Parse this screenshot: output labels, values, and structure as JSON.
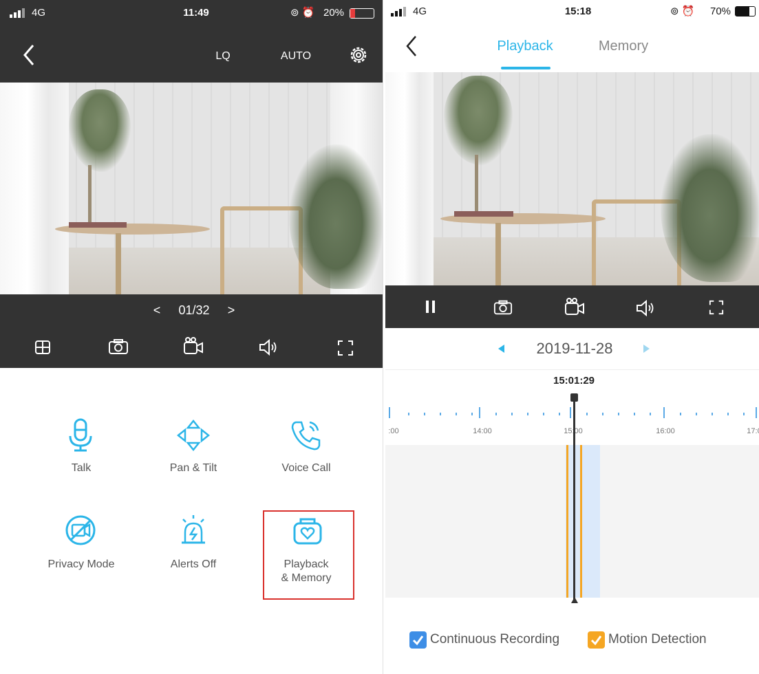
{
  "left": {
    "status": {
      "signal": "4G",
      "time": "11:49",
      "battery": "20%"
    },
    "header": {
      "quality": "LQ",
      "mode": "AUTO",
      "back_icon": "chevron-left-icon",
      "settings_icon": "gear-icon"
    },
    "pager": {
      "label": "01/32",
      "prev": "<",
      "next": ">"
    },
    "toolbar": [
      "grid-view-icon",
      "camera-icon",
      "record-icon",
      "speaker-icon",
      "fullscreen-icon"
    ],
    "functions": {
      "talk": "Talk",
      "pan_tilt": "Pan & Tilt",
      "voice_call": "Voice Call",
      "privacy": "Privacy Mode",
      "alerts": "Alerts Off",
      "playback_line1": "Playback",
      "playback_line2": "& Memory"
    },
    "highlight_color": "#d9302c"
  },
  "right": {
    "status": {
      "signal": "4G",
      "time": "15:18",
      "battery": "70%"
    },
    "tabs": {
      "playback": "Playback",
      "memory": "Memory"
    },
    "date": "2019-11-28",
    "current_time": "15:01:29",
    "ticks": [
      ":00",
      "14:00",
      "15:00",
      "16:00",
      "17:0"
    ],
    "legend": {
      "continuous": "Continuous Recording",
      "motion": "Motion Detection"
    },
    "colors": {
      "accent": "#2bb5e8",
      "continuous": "#3d8ee6",
      "motion": "#f5a623"
    }
  }
}
